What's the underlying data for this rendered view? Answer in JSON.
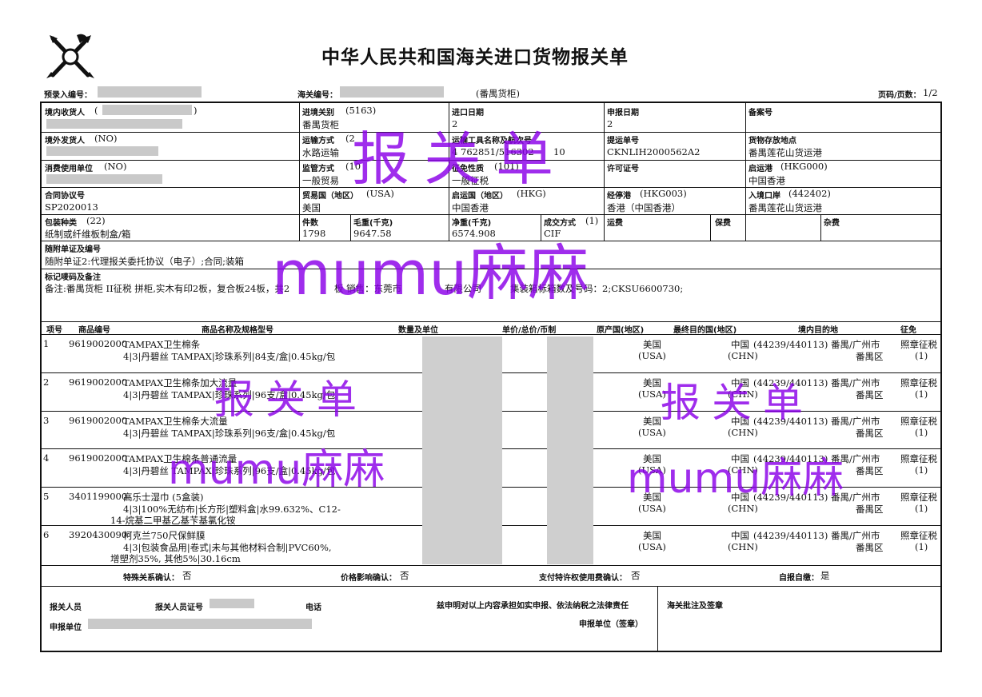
{
  "header": {
    "title": "中华人民共和国海关进口货物报关单",
    "pre_entry_label": "预录入编号：",
    "customs_no_label": "海关编号：",
    "site": "(番禺货柜)",
    "page_label": "页码/页数：",
    "page_value": "1/2",
    "logo_icon": "customs-emblem-icon"
  },
  "fields": {
    "consignee_label": "境内收货人",
    "consignee_paren_open": "(",
    "consignee_paren_close": ")",
    "entry_port_label": "进境关别",
    "entry_port_code": "(5163)",
    "entry_port_value": "番禺货柜",
    "import_date_label": "进口日期",
    "import_date_value": "2",
    "declare_date_label": "申报日期",
    "declare_date_value": "2",
    "record_no_label": "备案号",
    "foreign_shipper_label": "境外发货人",
    "foreign_shipper_code": "(NO)",
    "transport_mode_label": "运输方式",
    "transport_mode_code": "(2",
    "transport_mode_value": "水路运输",
    "transport_tool_label": "运输工具名称及航次号",
    "transport_tool_value": "4",
    "transport_tool_value2": "762851/516302",
    "transport_tool_value3": "10",
    "bill_no_label": "提运单号",
    "bill_no_value": "CKNLIH2000562A2",
    "storage_label": "货物存放地点",
    "storage_value": "番禺莲花山货运港",
    "consumer_label": "消费使用单位",
    "consumer_code": "(NO)",
    "supervision_label": "监管方式",
    "supervision_code": "(10",
    "supervision_value": "一般贸易",
    "levy_label": "征免性质",
    "levy_code": "(101)",
    "levy_value": "一般征税",
    "license_label": "许可证号",
    "departure_port_label": "启运港",
    "departure_port_code": "(HKG000)",
    "departure_port_value": "中国香港",
    "contract_label": "合同协议号",
    "contract_value": "SP2020013",
    "trade_country_label": "贸易国（地区）",
    "trade_country_code": "(USA)",
    "trade_country_value": "美国",
    "origin_country_label": "启运国（地区）",
    "origin_country_code": "(HKG)",
    "origin_country_value": "中国香港",
    "transit_port_label": "经停港",
    "transit_port_code": "(HKG003)",
    "transit_port_value": "香港（中国香港）",
    "entry_place_label": "入境口岸",
    "entry_place_code": "(442402)",
    "entry_place_value": "番禺莲花山货运港",
    "package_label": "包装种类",
    "package_code": "(22)",
    "package_value": "纸制或纤维板制盒/箱",
    "pieces_label": "件数",
    "pieces_value": "1798",
    "gross_label": "毛重(千克)",
    "gross_value": "9647.58",
    "net_label": "净重(千克)",
    "net_value": "6574.908",
    "deal_label": "成交方式",
    "deal_code": "(1)",
    "deal_value": "CIF",
    "freight_label": "运费",
    "insurance_label": "保费",
    "misc_label": "杂费",
    "docs_label": "随附单证及编号",
    "docs_value": "随附单证2:代理报关委托协议（电子）;合同;装箱",
    "marks_label": "标记唛码及备注",
    "marks_value1": "备注:番禺货柜 II征税 拼柜,实木有印2板，复合板24板，共2",
    "marks_value2": "板 销售：东莞市",
    "marks_value3": "有限公司",
    "marks_value4": "集装箱标箱数及号码：2;CKSU6600730;"
  },
  "table": {
    "headers": [
      "项号",
      "商品编号",
      "商品名称及规格型号",
      "数量及单位",
      "单价/总价/币制",
      "原产国(地区)",
      "最终目的国(地区)",
      "境内目的地",
      "征免"
    ],
    "items": [
      {
        "no": "1",
        "code": "9619002000",
        "name": "TAMPAX卫生棉条",
        "spec": "4|3|丹碧丝 TAMPAX|珍珠系列|84支/盒|0.45kg/包",
        "spec2": "",
        "origin": "美国",
        "origin_code": "(USA)",
        "dest": "中国",
        "dest_code": "(CHN)",
        "dest_region": "(44239/440113) 番禺/广州市",
        "dest_region2": "番禺区",
        "levy": "照章征税",
        "levy_code": "(1)"
      },
      {
        "no": "2",
        "code": "9619002000",
        "name": "TAMPAX卫生棉条加大流量",
        "spec": "4|3|丹碧丝 TAMPAX|珍珠系列|96支/盒|0.45kg/包",
        "spec2": "",
        "origin": "美国",
        "origin_code": "(USA)",
        "dest": "中国",
        "dest_code": "(CHN)",
        "dest_region": "(44239/440113) 番禺/广州市",
        "dest_region2": "番禺区",
        "levy": "照章征税",
        "levy_code": "(1)"
      },
      {
        "no": "3",
        "code": "9619002000",
        "name": "TAMPAX卫生棉条大流量",
        "spec": "4|3|丹碧丝 TAMPAX|珍珠系列|96支/盒|0.45kg/包",
        "spec2": "",
        "origin": "美国",
        "origin_code": "(USA)",
        "dest": "中国",
        "dest_code": "(CHN)",
        "dest_region": "(44239/440113) 番禺/广州市",
        "dest_region2": "番禺区",
        "levy": "照章征税",
        "levy_code": "(1)"
      },
      {
        "no": "4",
        "code": "9619002000",
        "name": "TAMPAX卫生棉条普通流量",
        "spec": "4|3|丹碧丝 TAMPAX|珍珠系列|96支/盒|0.45kg/包",
        "spec2": "",
        "origin": "美国",
        "origin_code": "(USA)",
        "dest": "中国",
        "dest_code": "(CHN)",
        "dest_region": "(44239/440113) 番禺/广州市",
        "dest_region2": "番禺区",
        "levy": "照章征税",
        "levy_code": "(1)"
      },
      {
        "no": "5",
        "code": "3401199000",
        "name": "高乐士湿巾 (5盒装)",
        "spec": "4|3|100%无纺布|长方形|塑料盒|水99.632%、C12-",
        "spec2": "14-烷基二甲基乙基苄基氯化铵",
        "origin": "美国",
        "origin_code": "(USA)",
        "dest": "中国",
        "dest_code": "(CHN)",
        "dest_region": "(44239/440113) 番禺/广州市",
        "dest_region2": "番禺区",
        "levy": "照章征税",
        "levy_code": "(1)"
      },
      {
        "no": "6",
        "code": "3920430090",
        "name": "柯克兰750尺保鲜膜",
        "spec": "4|3|包装食品用|卷式|未与其他材料合制|PVC60%,",
        "spec2": "增塑剂35%, 其他5%|30.16cm",
        "origin": "美国",
        "origin_code": "(USA)",
        "dest": "中国",
        "dest_code": "(CHN)",
        "dest_region": "(44239/440113) 番禺/广州市",
        "dest_region2": "番禺区",
        "levy": "照章征税",
        "levy_code": "(1)"
      }
    ]
  },
  "confirm": {
    "special_label": "特殊关系确认：",
    "special_value": "否",
    "price_label": "价格影响确认：",
    "price_value": "否",
    "royalty_label": "支付特许权使用费确认：",
    "royalty_value": "否",
    "self_report_label": "自报自缴：",
    "self_report_value": "是"
  },
  "footer": {
    "declarant_label": "报关人员",
    "declarant_cert_label": "报关人员证号",
    "phone_label": "电话",
    "statement": "兹申明对以上内容承担如实申报、依法纳税之法律责任",
    "customs_note_label": "海关批注及签章",
    "declare_unit_label": "申报单位",
    "declare_unit_seal": "申报单位（签章）"
  },
  "watermarks": {
    "big1": "报关单",
    "big2": "mumu麻麻",
    "small1": "报关单",
    "small2": "mumu麻麻",
    "small3": "报关单",
    "small4": "mumu麻麻",
    "color": "#8b00e8"
  }
}
